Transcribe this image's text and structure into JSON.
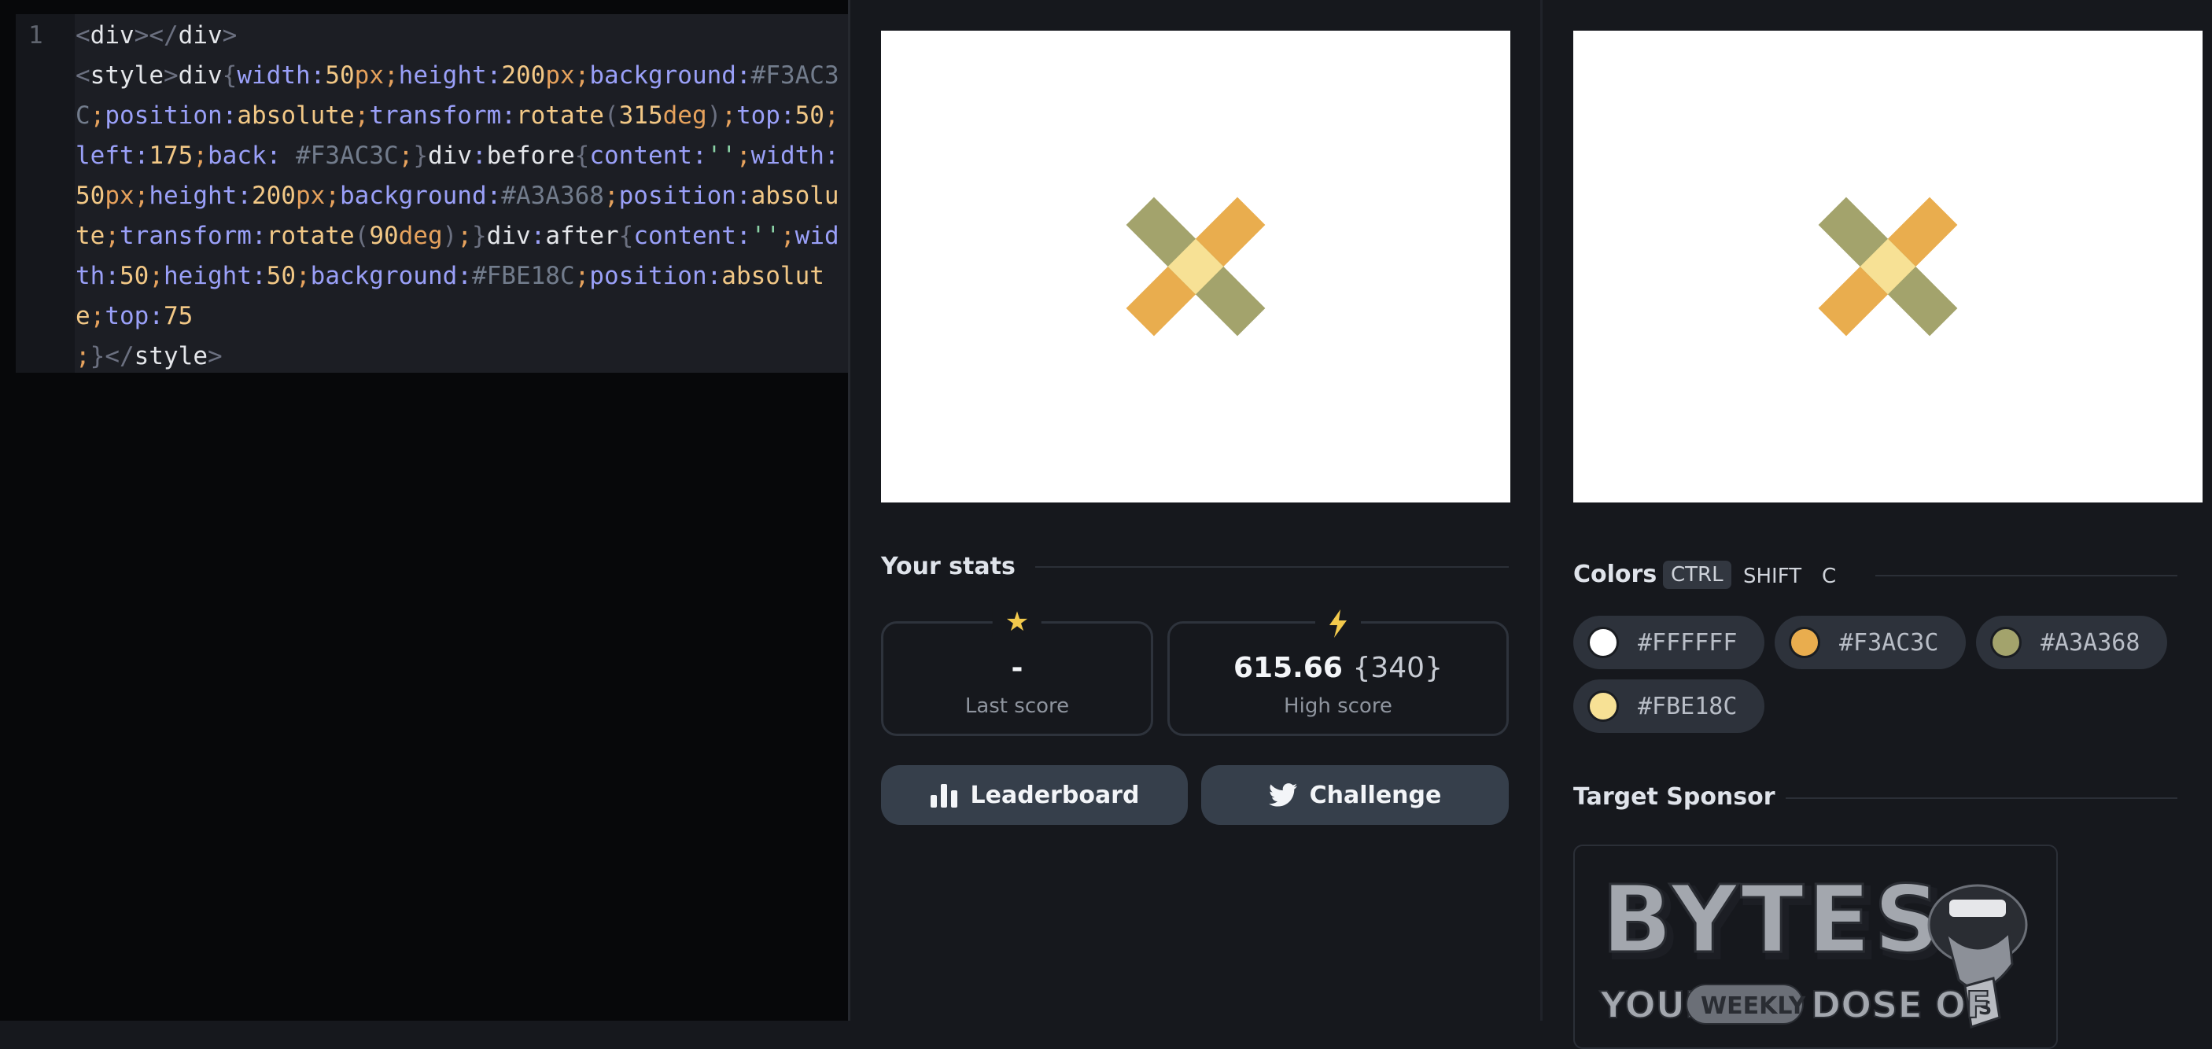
{
  "editor": {
    "line_number": "1",
    "code_tokens": [
      {
        "t": "<",
        "c": "t-p"
      },
      {
        "t": "div",
        "c": ""
      },
      {
        "t": "></",
        "c": "t-p"
      },
      {
        "t": "div",
        "c": ""
      },
      {
        "t": ">",
        "c": "t-p"
      },
      {
        "t": "\n",
        "c": ""
      },
      {
        "t": "<",
        "c": "t-p"
      },
      {
        "t": "style",
        "c": ""
      },
      {
        "t": ">",
        "c": "t-p"
      },
      {
        "t": "div",
        "c": ""
      },
      {
        "t": "{",
        "c": "t-p"
      },
      {
        "t": "width",
        "c": "t-k"
      },
      {
        "t": ":",
        "c": "t-k"
      },
      {
        "t": "50",
        "c": "t-v"
      },
      {
        "t": "px",
        "c": "t-u"
      },
      {
        "t": ";",
        "c": "t-u"
      },
      {
        "t": "height",
        "c": "t-k"
      },
      {
        "t": ":",
        "c": "t-k"
      },
      {
        "t": "200",
        "c": "t-v"
      },
      {
        "t": "px",
        "c": "t-u"
      },
      {
        "t": ";",
        "c": "t-u"
      },
      {
        "t": "background",
        "c": "t-k"
      },
      {
        "t": ":",
        "c": "t-k"
      },
      {
        "t": "#F3AC3C",
        "c": "t-h"
      },
      {
        "t": ";",
        "c": "t-u"
      },
      {
        "t": "position",
        "c": "t-k"
      },
      {
        "t": ":",
        "c": "t-k"
      },
      {
        "t": "absolute",
        "c": "t-v"
      },
      {
        "t": ";",
        "c": "t-u"
      },
      {
        "t": "transform",
        "c": "t-k"
      },
      {
        "t": ":",
        "c": "t-k"
      },
      {
        "t": "rotate",
        "c": "t-v"
      },
      {
        "t": "(",
        "c": "t-p"
      },
      {
        "t": "315",
        "c": "t-v"
      },
      {
        "t": "deg",
        "c": "t-u"
      },
      {
        "t": ")",
        "c": "t-p"
      },
      {
        "t": ";",
        "c": "t-u"
      },
      {
        "t": "top",
        "c": "t-k"
      },
      {
        "t": ":",
        "c": "t-k"
      },
      {
        "t": "50",
        "c": "t-v"
      },
      {
        "t": ";",
        "c": "t-u"
      },
      {
        "t": "left",
        "c": "t-k"
      },
      {
        "t": ":",
        "c": "t-k"
      },
      {
        "t": "175",
        "c": "t-v"
      },
      {
        "t": ";",
        "c": "t-u"
      },
      {
        "t": "back",
        "c": "t-k"
      },
      {
        "t": ":",
        "c": "t-k"
      },
      {
        "t": " ",
        "c": ""
      },
      {
        "t": "#F3AC3C",
        "c": "t-h"
      },
      {
        "t": ";",
        "c": "t-u"
      },
      {
        "t": "}",
        "c": "t-p"
      },
      {
        "t": "div",
        "c": ""
      },
      {
        "t": ":",
        "c": "t-k"
      },
      {
        "t": "before",
        "c": ""
      },
      {
        "t": "{",
        "c": "t-p"
      },
      {
        "t": "content",
        "c": "t-k"
      },
      {
        "t": ":",
        "c": "t-k"
      },
      {
        "t": "''",
        "c": "t-s"
      },
      {
        "t": ";",
        "c": "t-u"
      },
      {
        "t": "width",
        "c": "t-k"
      },
      {
        "t": ":",
        "c": "t-k"
      },
      {
        "t": "50",
        "c": "t-v"
      },
      {
        "t": "px",
        "c": "t-u"
      },
      {
        "t": ";",
        "c": "t-u"
      },
      {
        "t": "height",
        "c": "t-k"
      },
      {
        "t": ":",
        "c": "t-k"
      },
      {
        "t": "200",
        "c": "t-v"
      },
      {
        "t": "px",
        "c": "t-u"
      },
      {
        "t": ";",
        "c": "t-u"
      },
      {
        "t": "background",
        "c": "t-k"
      },
      {
        "t": ":",
        "c": "t-k"
      },
      {
        "t": "#A3A368",
        "c": "t-h"
      },
      {
        "t": ";",
        "c": "t-u"
      },
      {
        "t": "position",
        "c": "t-k"
      },
      {
        "t": ":",
        "c": "t-k"
      },
      {
        "t": "absolute",
        "c": "t-v"
      },
      {
        "t": ";",
        "c": "t-u"
      },
      {
        "t": "transform",
        "c": "t-k"
      },
      {
        "t": ":",
        "c": "t-k"
      },
      {
        "t": "rotate",
        "c": "t-v"
      },
      {
        "t": "(",
        "c": "t-p"
      },
      {
        "t": "90",
        "c": "t-v"
      },
      {
        "t": "deg",
        "c": "t-u"
      },
      {
        "t": ")",
        "c": "t-p"
      },
      {
        "t": ";",
        "c": "t-u"
      },
      {
        "t": "}",
        "c": "t-p"
      },
      {
        "t": "div",
        "c": ""
      },
      {
        "t": ":",
        "c": "t-k"
      },
      {
        "t": "after",
        "c": ""
      },
      {
        "t": "{",
        "c": "t-p"
      },
      {
        "t": "content",
        "c": "t-k"
      },
      {
        "t": ":",
        "c": "t-k"
      },
      {
        "t": "''",
        "c": "t-s"
      },
      {
        "t": ";",
        "c": "t-u"
      },
      {
        "t": "width",
        "c": "t-k"
      },
      {
        "t": ":",
        "c": "t-k"
      },
      {
        "t": "50",
        "c": "t-v"
      },
      {
        "t": ";",
        "c": "t-u"
      },
      {
        "t": "height",
        "c": "t-k"
      },
      {
        "t": ":",
        "c": "t-k"
      },
      {
        "t": "50",
        "c": "t-v"
      },
      {
        "t": ";",
        "c": "t-u"
      },
      {
        "t": "background",
        "c": "t-k"
      },
      {
        "t": ":",
        "c": "t-k"
      },
      {
        "t": "#FBE18C",
        "c": "t-h"
      },
      {
        "t": ";",
        "c": "t-u"
      },
      {
        "t": "position",
        "c": "t-k"
      },
      {
        "t": ":",
        "c": "t-k"
      },
      {
        "t": "absolute",
        "c": "t-v"
      },
      {
        "t": ";",
        "c": "t-u"
      },
      {
        "t": "top",
        "c": "t-k"
      },
      {
        "t": ":",
        "c": "t-k"
      },
      {
        "t": "75",
        "c": "t-v"
      },
      {
        "t": "\n",
        "c": ""
      },
      {
        "t": ";",
        "c": "t-u"
      },
      {
        "t": "}",
        "c": "t-p"
      },
      {
        "t": "</",
        "c": "t-p"
      },
      {
        "t": "style",
        "c": ""
      },
      {
        "t": ">",
        "c": "t-p"
      }
    ]
  },
  "output_preview": {
    "colors": {
      "orange": "#e9ad4e",
      "olive": "#a3a36c",
      "center": "#f7e195",
      "background": "#ffffff"
    }
  },
  "target_preview": {
    "colors": {
      "orange": "#e9ad4e",
      "olive": "#a3a36c",
      "center": "#f7e195",
      "background": "#ffffff"
    }
  },
  "stats": {
    "title": "Your stats",
    "last_score": {
      "icon": "star-icon",
      "value": "-",
      "label": "Last score"
    },
    "high_score": {
      "icon": "lightning-icon",
      "value": "615.66",
      "extra": "{340}",
      "label": "High score"
    }
  },
  "actions": {
    "leaderboard_label": "Leaderboard",
    "challenge_label": "Challenge"
  },
  "colors_section": {
    "title": "Colors",
    "shortcut": [
      "CTRL",
      "SHIFT",
      "C"
    ],
    "swatches": [
      {
        "hex": "#FFFFFF"
      },
      {
        "hex": "#F3AC3C"
      },
      {
        "hex": "#A3A368"
      },
      {
        "hex": "#FBE18C"
      }
    ],
    "swatch_display_colors": [
      "#ffffff",
      "#e9ad4e",
      "#a3a36c",
      "#f7e195"
    ]
  },
  "sponsor": {
    "title": "Target Sponsor",
    "logo_lines": [
      "BYTES",
      "YOUR",
      "WEEKLY",
      "DOSE OF",
      "JS"
    ]
  }
}
